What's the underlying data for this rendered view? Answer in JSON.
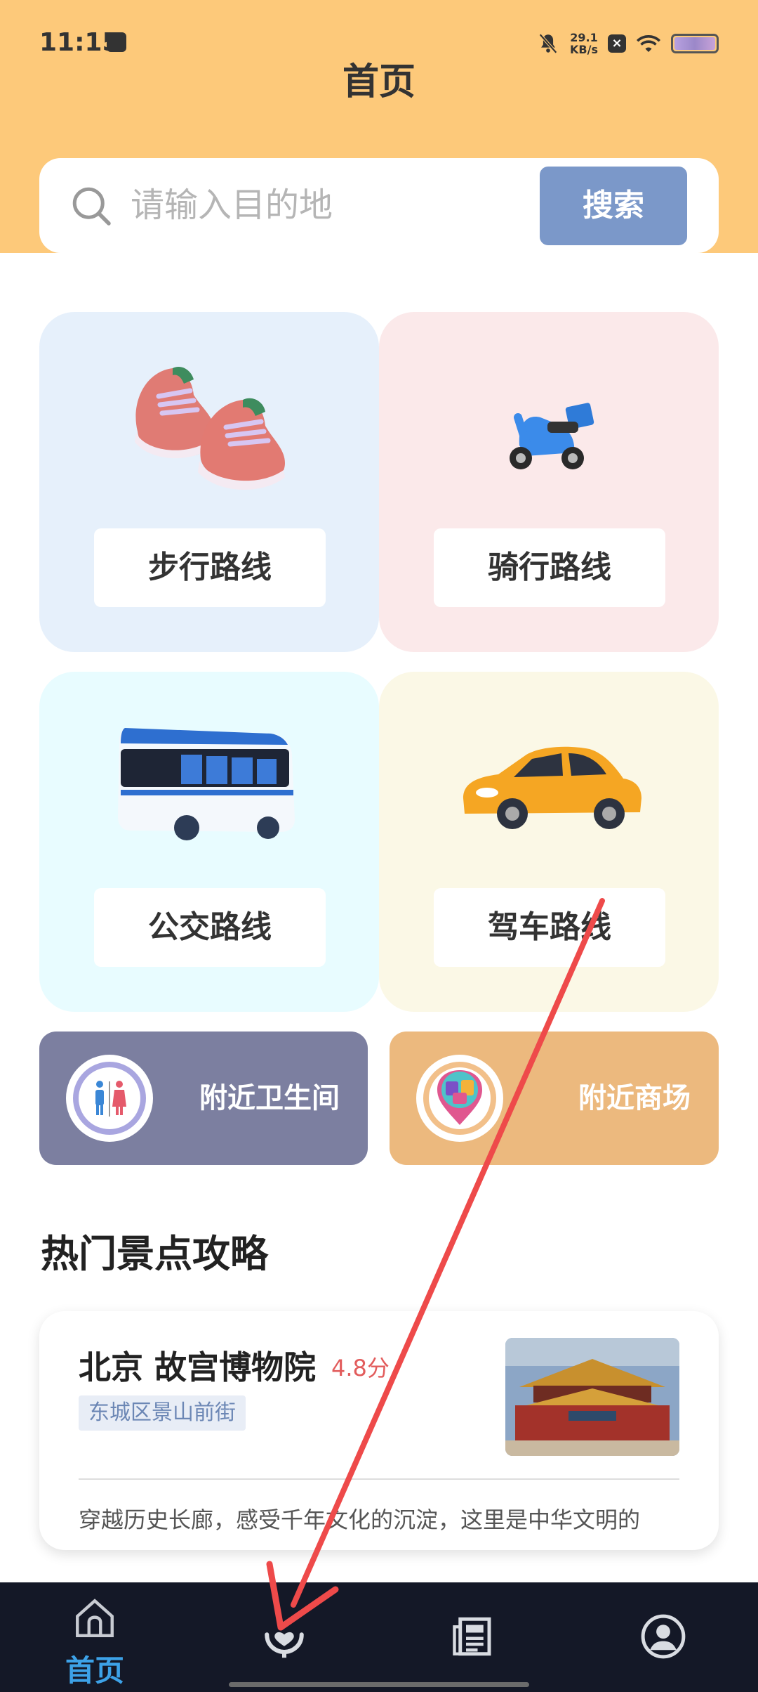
{
  "status_bar": {
    "time": "11:15",
    "net_speed_value": "29.1",
    "net_speed_unit": "KB/s"
  },
  "header": {
    "title": "首页"
  },
  "search": {
    "placeholder": "请输入目的地",
    "button_label": "搜索"
  },
  "route_cards": [
    {
      "label": "步行路线",
      "icon": "sneakers-icon"
    },
    {
      "label": "骑行路线",
      "icon": "scooter-icon"
    },
    {
      "label": "公交路线",
      "icon": "bus-icon"
    },
    {
      "label": "驾车路线",
      "icon": "car-icon"
    }
  ],
  "nearby": {
    "toilet_label": "附近卫生间",
    "mall_label": "附近商场"
  },
  "hot_spots": {
    "section_title": "热门景点攻略",
    "items": [
      {
        "name": "北京 故宫博物院",
        "rating": "4.8分",
        "location": "东城区景山前街",
        "description": "穿越历史长廊，感受千年文化的沉淀，这里是中华文明的"
      }
    ]
  },
  "bottom_nav": {
    "home_label": "首页",
    "active_color": "#3DA2E8",
    "items": [
      "home-icon",
      "heart-hands-icon",
      "news-icon",
      "profile-icon"
    ]
  },
  "colors": {
    "header_bg": "#FDC97A",
    "search_button": "#7B98C9",
    "nav_bg": "#141827",
    "annotation_arrow": "#EE4A4A"
  }
}
